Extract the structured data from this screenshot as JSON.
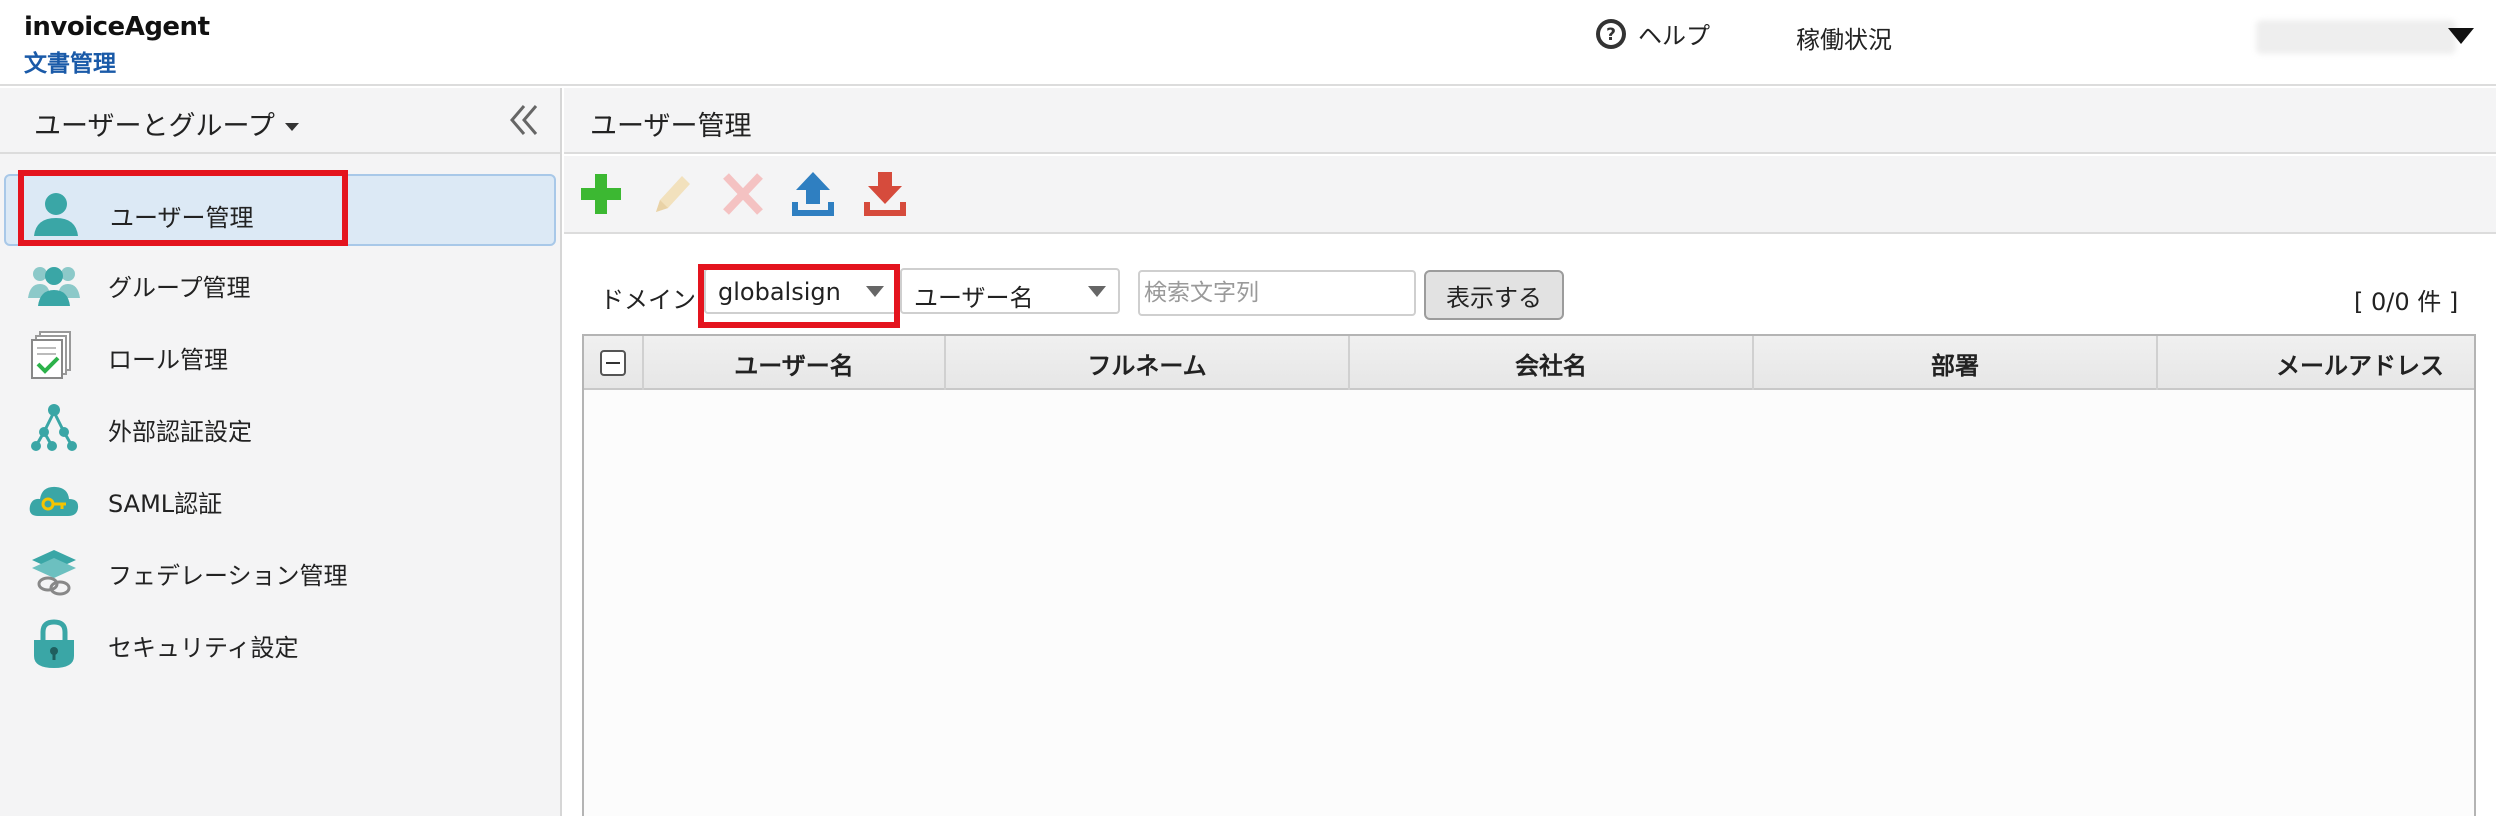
{
  "header": {
    "app_name": "invoiceAgent",
    "app_sub": "文書管理",
    "help_label": "ヘルプ",
    "status_label": "稼働状況"
  },
  "sidebar": {
    "title": "ユーザーとグループ",
    "items": [
      {
        "label": "ユーザー管理",
        "icon": "user-icon",
        "active": true
      },
      {
        "label": "グループ管理",
        "icon": "group-icon"
      },
      {
        "label": "ロール管理",
        "icon": "role-documents-icon"
      },
      {
        "label": "外部認証設定",
        "icon": "network-tree-icon"
      },
      {
        "label": "SAML認証",
        "icon": "cloud-key-icon"
      },
      {
        "label": "フェデレーション管理",
        "icon": "federation-chain-icon"
      },
      {
        "label": "セキュリティ設定",
        "icon": "lock-icon"
      }
    ]
  },
  "main": {
    "title": "ユーザー管理",
    "toolbar": [
      "add-icon",
      "edit-icon",
      "delete-icon",
      "upload-icon",
      "download-icon"
    ]
  },
  "filter": {
    "domain_label": "ドメイン",
    "domain_value": "globalsign",
    "field_value": "ユーザー名",
    "search_placeholder": "検索文字列",
    "search_value": "",
    "show_button": "表示する",
    "count": "[ 0/0 件 ]"
  },
  "table": {
    "columns": [
      "ユーザー名",
      "フルネーム",
      "会社名",
      "部署",
      "メールアドレス"
    ],
    "rows": []
  },
  "colors": {
    "brand_blue": "#1a5aa8",
    "highlight_red": "#e4141e",
    "active_bg": "#dce9f5",
    "teal_icon": "#3aa6a6"
  }
}
